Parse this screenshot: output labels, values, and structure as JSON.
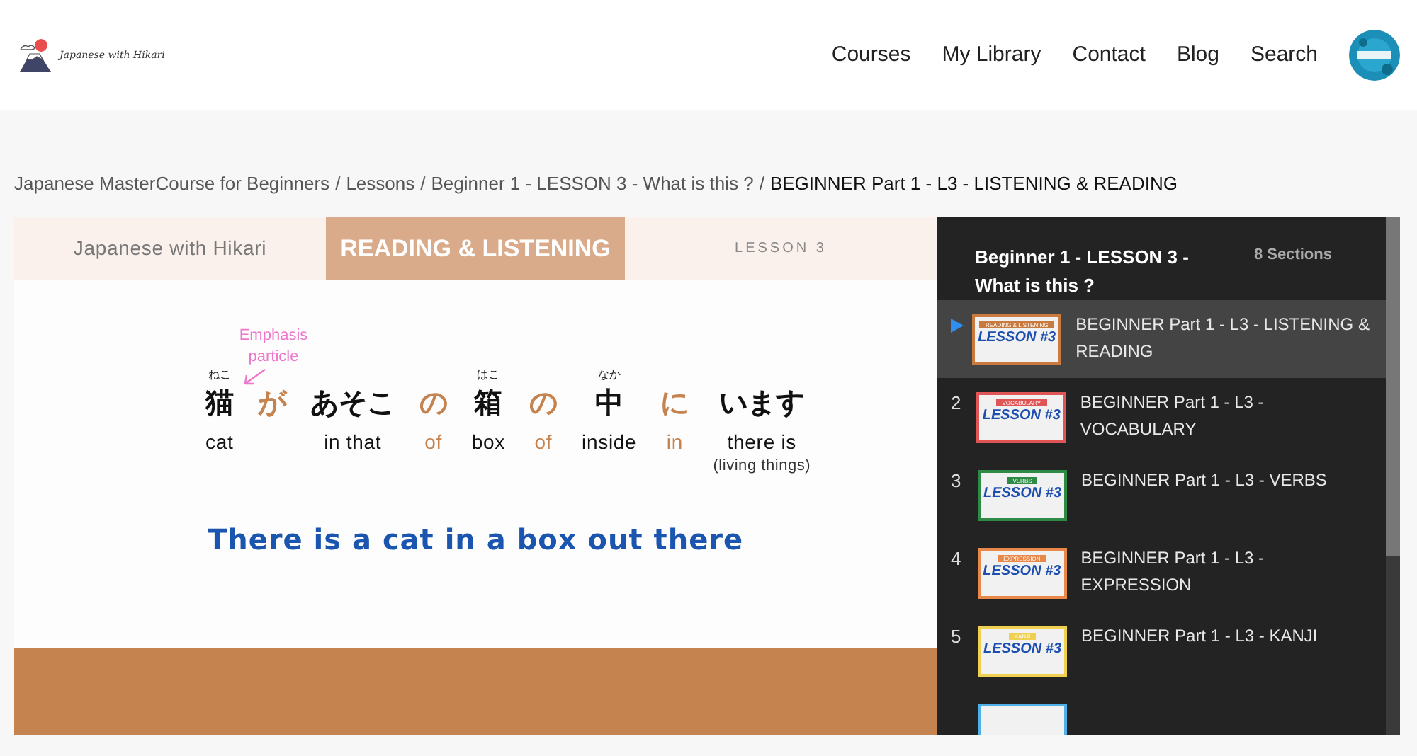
{
  "header": {
    "logo_text": "Japanese with Hikari",
    "nav": [
      "Courses",
      "My Library",
      "Contact",
      "Blog",
      "Search"
    ]
  },
  "breadcrumb": {
    "links": [
      "Japanese MasterCourse for Beginners",
      "Lessons",
      "Beginner 1 - LESSON 3 - What is this ?"
    ],
    "separator": "/",
    "current": "BEGINNER Part 1 - L3 - LISTENING & READING"
  },
  "video": {
    "brand": "Japanese with Hikari",
    "banner": "READING & LISTENING",
    "lesson": "LESSON 3",
    "note": "Emphasis particle",
    "words": [
      {
        "ruby": "ねこ",
        "word": "猫",
        "gloss": "cat",
        "kind": "main"
      },
      {
        "word": "が",
        "kind": "particle"
      },
      {
        "word": "あそこ",
        "gloss": "in that",
        "kind": "main"
      },
      {
        "word": "の",
        "gloss": "of",
        "kind": "particle"
      },
      {
        "ruby": "はこ",
        "word": "箱",
        "gloss": "box",
        "kind": "main"
      },
      {
        "word": "の",
        "gloss": "of",
        "kind": "particle"
      },
      {
        "ruby": "なか",
        "word": "中",
        "gloss": "inside",
        "kind": "main"
      },
      {
        "word": "に",
        "gloss": "in",
        "kind": "particle"
      },
      {
        "word": "います",
        "gloss": "there is",
        "sub": "(living things)",
        "kind": "main"
      }
    ],
    "translation": "There is a cat in a box out there"
  },
  "sidebar": {
    "title": "Beginner 1 - LESSON 3 - What is this ?",
    "count": "8 Sections",
    "items": [
      {
        "selected": true,
        "title": "BEGINNER Part 1 - L3 - LISTENING & READING",
        "thumb_tag": "READING & LISTENING",
        "thumb_text": "LESSON #3",
        "color": "#c97a3e"
      },
      {
        "selected": false,
        "number": "2",
        "title": "BEGINNER Part 1 - L3 - VOCABULARY",
        "thumb_tag": "VOCABULARY",
        "thumb_text": "LESSON #3",
        "color": "#e05555"
      },
      {
        "selected": false,
        "number": "3",
        "title": "BEGINNER Part 1 - L3 - VERBS",
        "thumb_tag": "VERBS",
        "thumb_text": "LESSON #3",
        "color": "#2e8b45"
      },
      {
        "selected": false,
        "number": "4",
        "title": "BEGINNER Part 1 - L3 - EXPRESSION",
        "thumb_tag": "EXPRESSION",
        "thumb_text": "LESSON #3",
        "color": "#e8894a"
      },
      {
        "selected": false,
        "number": "5",
        "title": "BEGINNER Part 1 - L3 - KANJI",
        "thumb_tag": "KANJI",
        "thumb_text": "LESSON #3",
        "color": "#f0d050"
      },
      {
        "selected": false,
        "color": "#4fb0e8"
      }
    ]
  }
}
